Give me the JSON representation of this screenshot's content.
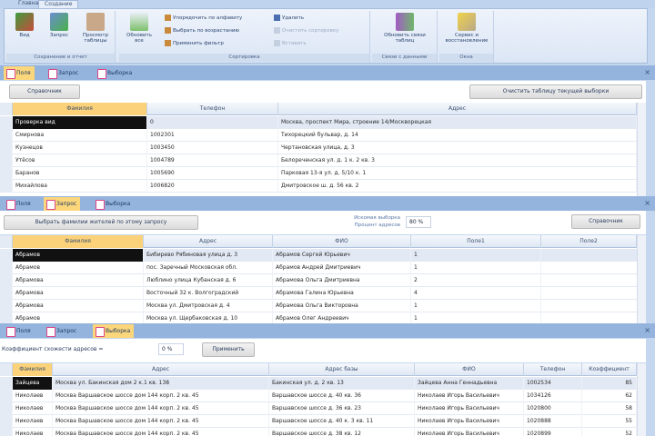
{
  "ribbon": {
    "tabs": [
      "Главная",
      "Создание"
    ],
    "groups": [
      {
        "label": "Сохранение и отчет",
        "buttons": [
          "Вид",
          "Запрос",
          "Просмотр таблицы"
        ]
      },
      {
        "label": "Сортировка",
        "buttons": [
          "Обновить все"
        ],
        "small": [
          "Упорядочить по алфавиту",
          "Выбрать по возрастанию",
          "Применить фильтр",
          "Удалить",
          "Очистить сортировку",
          "Вставить"
        ]
      },
      {
        "label": "Связи с данными",
        "buttons": [
          "Обновить связи таблиц"
        ]
      },
      {
        "label": "Окна",
        "buttons": [
          "Сервис и восстановление"
        ]
      }
    ]
  },
  "win1": {
    "tabs": [
      "Поля",
      "Запрос",
      "Выборка"
    ],
    "active": 0,
    "refresh_btn": "Справочник",
    "clear_btn": "Очистить таблицу текущей выборки",
    "columns": [
      "Фамилия",
      "Телефон",
      "Адрес"
    ],
    "rows": [
      [
        "Проверка вид",
        "0",
        "Москва, проспект Мира, строение 14/Москворецкая"
      ],
      [
        "Смирнова",
        "1002301",
        "Тихорецкий бульвар, д. 14"
      ],
      [
        "Кузнецов",
        "1003450",
        "Чертановская улица, д. 3"
      ],
      [
        "Утёсов",
        "1004789",
        "Белореченская ул. д. 1 к. 2 кв. 3"
      ],
      [
        "Баранов",
        "1005690",
        "Парковая 13-я ул. д. 5/10 к. 1"
      ],
      [
        "Михайлова",
        "1006820",
        "Дмитровское ш. д. 56 кв. 2"
      ]
    ]
  },
  "win2": {
    "tabs": [
      "Поля",
      "Запрос",
      "Выборка"
    ],
    "active": 1,
    "run_btn": "Выбрать фамилии жителей по этому запросу",
    "label1": "Искомая выборка",
    "label2": "Процент адресов",
    "value": "80 %",
    "ref_btn": "Справочник",
    "columns": [
      "Фамилия",
      "Адрес",
      "ФИО",
      "Поле1",
      "Поле2"
    ],
    "rows": [
      [
        "Абрамов",
        "Бибирево Рябиновая улица д. 3",
        "Абрамов Сергей Юрьевич",
        "1"
      ],
      [
        "Абрамов",
        "пос. Заречный Московская обл.",
        "Абрамов Андрей Дмитриевич",
        "1"
      ],
      [
        "Абрамова",
        "Люблино улица Кубанская д. 6",
        "Абрамова Ольга Дмитриевна",
        "2"
      ],
      [
        "Абрамова",
        "Восточный 32 к. Волгоградский",
        "Абрамова Галина Юрьевна",
        "4"
      ],
      [
        "Абрамова",
        "Москва ул. Дмитровская д. 4",
        "Абрамова Ольга Викторовна",
        "1"
      ],
      [
        "Абрамов",
        "Москва ул. Щербаковская д. 10",
        "Абрамов Олег Андреевич",
        "1"
      ]
    ]
  },
  "win3": {
    "tabs": [
      "Поля",
      "Запрос",
      "Выборка"
    ],
    "active": 2,
    "coef_label": "Коэффициент схожести адресов =",
    "coef_value": "0 %",
    "apply_btn": "Применить",
    "columns": [
      "Фамилия",
      "Адрес",
      "Адрес базы",
      "ФИО",
      "Телефон",
      "Коэффициент"
    ],
    "rows": [
      [
        "Зайцева",
        "Москва ул. Бакинская дом 2 к.1 кв. 138",
        "Бакинская ул. д. 2 кв. 13",
        "Зайцева Анна Геннадьевна",
        "1002534",
        "85"
      ],
      [
        "Николаев",
        "Москва Варшавское шоссе дом 144 корп. 2 кв. 45",
        "Варшавское шоссе д. 40 кв. 36",
        "Николаев Игорь Васильевич",
        "1034126",
        "62"
      ],
      [
        "Николаев",
        "Москва Варшавское шоссе дом 144 корп. 2 кв. 45",
        "Варшавское шоссе д. 36 кв. 23",
        "Николаев Игорь Васильевич",
        "1020800",
        "58"
      ],
      [
        "Николаев",
        "Москва Варшавское шоссе дом 144 корп. 2 кв. 45",
        "Варшавское шоссе д. 40 к. 3 кв. 11",
        "Николаев Игорь Васильевич",
        "1020888",
        "55"
      ],
      [
        "Николаев",
        "Москва Варшавское шоссе дом 144 корп. 2 кв. 45",
        "Варшавское шоссе д. 38 кв. 12",
        "Николаев Игорь Васильевич",
        "1020899",
        "52"
      ]
    ]
  }
}
